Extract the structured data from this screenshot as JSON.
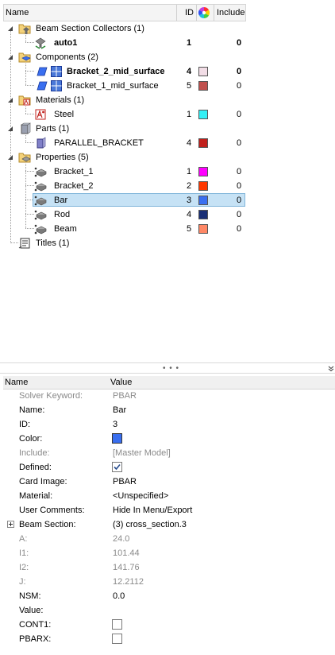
{
  "tree": {
    "headers": {
      "name": "Name",
      "id": "ID",
      "include": "Include"
    },
    "rows": [
      {
        "label": "Beam Section Collectors (1)"
      },
      {
        "label": "auto1",
        "id": "1",
        "include": "0"
      },
      {
        "label": "Components (2)"
      },
      {
        "label": "Bracket_2_mid_surface",
        "id": "4",
        "include": "0",
        "color": "#f2dde6"
      },
      {
        "label": "Bracket_1_mid_surface",
        "id": "5",
        "include": "0",
        "color": "#c0504d"
      },
      {
        "label": "Materials (1)"
      },
      {
        "label": "Steel",
        "id": "1",
        "include": "0",
        "color": "#33f0f5"
      },
      {
        "label": "Parts (1)"
      },
      {
        "label": "PARALLEL_BRACKET",
        "id": "4",
        "include": "0",
        "color": "#c0201c"
      },
      {
        "label": "Properties (5)"
      },
      {
        "label": "Bracket_1",
        "id": "1",
        "include": "0",
        "color": "#ff00ff"
      },
      {
        "label": "Bracket_2",
        "id": "2",
        "include": "0",
        "color": "#ff3800"
      },
      {
        "label": "Bar",
        "id": "3",
        "include": "0",
        "color": "#3a6ff0"
      },
      {
        "label": "Rod",
        "id": "4",
        "include": "0",
        "color": "#1a2f75"
      },
      {
        "label": "Beam",
        "id": "5",
        "include": "0",
        "color": "#ff8866"
      },
      {
        "label": "Titles (1)"
      }
    ]
  },
  "props": {
    "headers": {
      "name": "Name",
      "value": "Value"
    },
    "rows": [
      {
        "name": "Solver Keyword:",
        "value": "PBAR"
      },
      {
        "name": "Name:",
        "value": "Bar"
      },
      {
        "name": "ID:",
        "value": "3"
      },
      {
        "name": "Color:",
        "color": "#3a6ff0"
      },
      {
        "name": "Include:",
        "value": "[Master Model]"
      },
      {
        "name": "Defined:",
        "checked": true
      },
      {
        "name": "Card Image:",
        "value": "PBAR"
      },
      {
        "name": "Material:",
        "value": "<Unspecified>"
      },
      {
        "name": "User Comments:",
        "value": "Hide In Menu/Export"
      },
      {
        "name": "Beam Section:",
        "value": "(3) cross_section.3"
      },
      {
        "name": "A:",
        "value": "24.0"
      },
      {
        "name": "I1:",
        "value": "101.44"
      },
      {
        "name": "I2:",
        "value": "141.76"
      },
      {
        "name": "J:",
        "value": "12.2112"
      },
      {
        "name": "NSM:",
        "value": "0.0"
      },
      {
        "name": "Value:",
        "value": ""
      },
      {
        "name": "CONT1:",
        "checked": false
      },
      {
        "name": "PBARX:",
        "checked": false
      }
    ]
  }
}
